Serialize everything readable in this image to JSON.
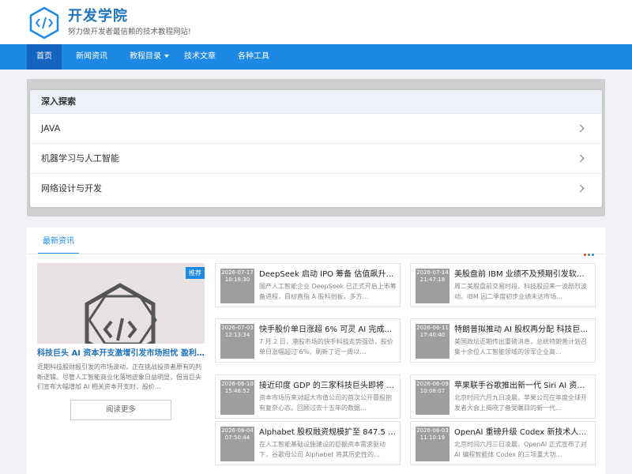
{
  "site": {
    "title": "开发学院",
    "subtitle": "努力做开发者最信赖的技术教程网站!"
  },
  "nav": {
    "items": [
      {
        "label": "首页"
      },
      {
        "label": "新闻资讯"
      },
      {
        "label": "教程目录"
      },
      {
        "label": "技术文章"
      },
      {
        "label": "各种工具"
      }
    ]
  },
  "explore": {
    "heading": "深入探索",
    "items": [
      {
        "label": "JAVA"
      },
      {
        "label": "机器学习与人工智能"
      },
      {
        "label": "网络设计与开发"
      }
    ]
  },
  "news": {
    "tab_label": "最新资讯",
    "dot_colors": [
      "#e53935",
      "#43a047",
      "#1e88e5"
    ],
    "featured": {
      "badge": "推荐",
      "title": "科技巨头 AI 资本开支激增引发市场担忧 盈利…",
      "desc": "近期科技股财报引发的市场波动，正在挑战投资者原有的判断逻辑。尽管人工智能商业化落地迹象日益明显，但当巨头们宣布大幅增加 AI 相关资本开支时，股价…",
      "read_more": "阅读更多"
    },
    "cards": [
      {
        "date": "2026-07-17",
        "time": "10:18:30",
        "title": "DeepSeek 启动 IPO 筹备 估值飙升…",
        "desc": "国产人工智能企业 DeepSeek 已正式开启上市筹备进程，目标直指 A 股科创板。多方…"
      },
      {
        "date": "2026-07-14",
        "time": "21:47:18",
        "title": "美股盘前 IBM 业绩不及预期引发软…",
        "desc": "周二美股盘前交易时段，科技股迎来一波剧烈波动。IBM 因二季度初步业绩未达市场…"
      },
      {
        "date": "2026-07-03",
        "time": "12:13:34",
        "title": "快手股价单日涨超 6% 可灵 AI 完成…",
        "desc": "7 月 2 日，港股市场的快手科技走势强劲，股价单日涨幅超过 6%，刷新了近一周以…"
      },
      {
        "date": "2026-06-11",
        "time": "17:40:40",
        "title": "特朗普拟推动 AI 股权再分配 科技巨…",
        "desc": "美国政坛近期传出重磅消息，总统特朗普计划召集十余位人工智能领域的领军企业高…"
      },
      {
        "date": "2026-06-10",
        "time": "15:48:52",
        "title": "接近印度 GDP 的三家科技巨头即将 …",
        "desc": "资本市场历来对超大市值公司的首次公开募股抱有复杂心态。回顾过去十五年的数据…"
      },
      {
        "date": "2026-06-09",
        "time": "10:08:07",
        "title": "苹果联手谷歌推出新一代 Siri AI 资…",
        "desc": "北京时间六月九日凌晨，苹果公司在年度全球开发者大会上揭晓了备受瞩目的新一代…"
      },
      {
        "date": "2026-06-04",
        "time": "07:50:44",
        "title": "Alphabet 股权融资规模扩至 847.5 …",
        "desc": "在人工智能基础设施建设的巨额资本需求驱动下，谷歌母公司 Alphabet 将其历史性的…"
      },
      {
        "date": "2026-06-03",
        "time": "11:10:19",
        "title": "OpenAI 重磅升级 Codex 新技术人…",
        "desc": "北京时间六月三日凌晨，OpenAI 正式宣布了对 AI 编程智能体 Codex 的三项重大功…"
      }
    ]
  }
}
